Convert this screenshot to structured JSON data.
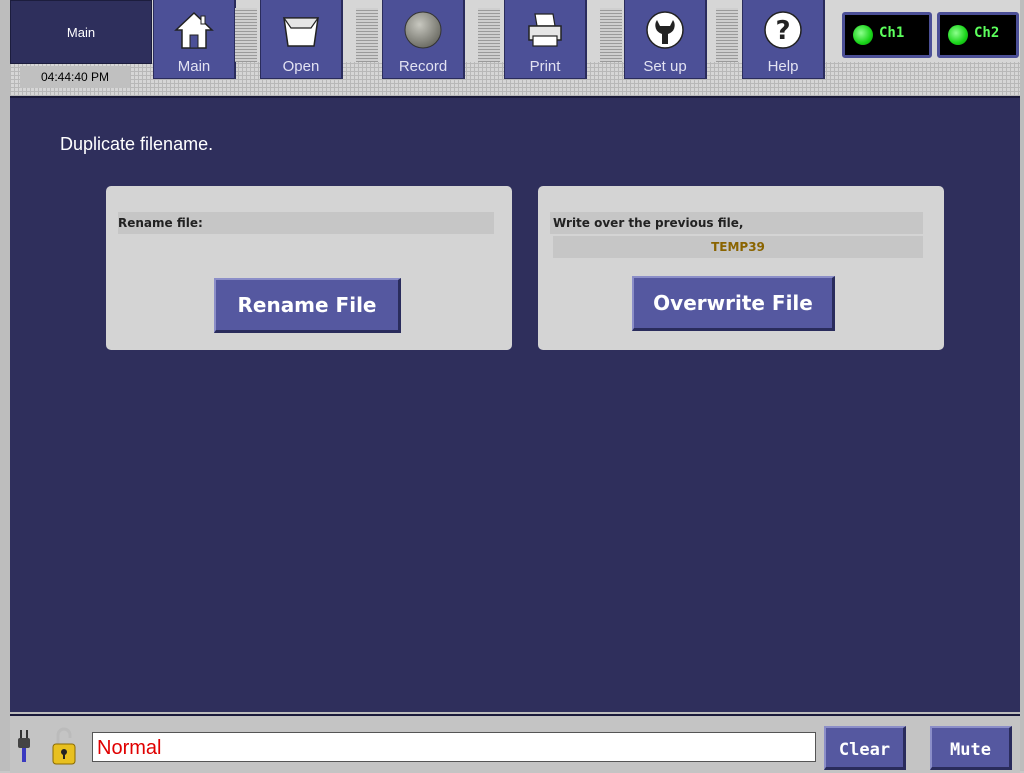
{
  "header": {
    "mode": "Main",
    "clock": "04:44:40 PM"
  },
  "toolbar": {
    "buttons": [
      {
        "label": "Main",
        "icon": "home-icon"
      },
      {
        "label": "Open",
        "icon": "folder-icon"
      },
      {
        "label": "Record",
        "icon": "record-icon"
      },
      {
        "label": "Print",
        "icon": "printer-icon"
      },
      {
        "label": "Set up",
        "icon": "wrench-icon"
      },
      {
        "label": "Help",
        "icon": "help-icon"
      }
    ],
    "channels": [
      {
        "label": "Ch1",
        "status_color": "#19d419"
      },
      {
        "label": "Ch2",
        "status_color": "#19d419"
      }
    ]
  },
  "main": {
    "heading": "Duplicate filename.",
    "rename_panel": {
      "label": "Rename file:",
      "value": "",
      "button": "Rename File"
    },
    "overwrite_panel": {
      "label": "Write over the previous file,",
      "filename": "TEMP39",
      "button": "Overwrite File"
    }
  },
  "footer": {
    "status": "Normal",
    "clear": "Clear",
    "mute": "Mute"
  },
  "colors": {
    "background": "#2f2f5c",
    "button": "#5558a0",
    "status_text": "#e00000",
    "filename_text": "#8a6400"
  }
}
